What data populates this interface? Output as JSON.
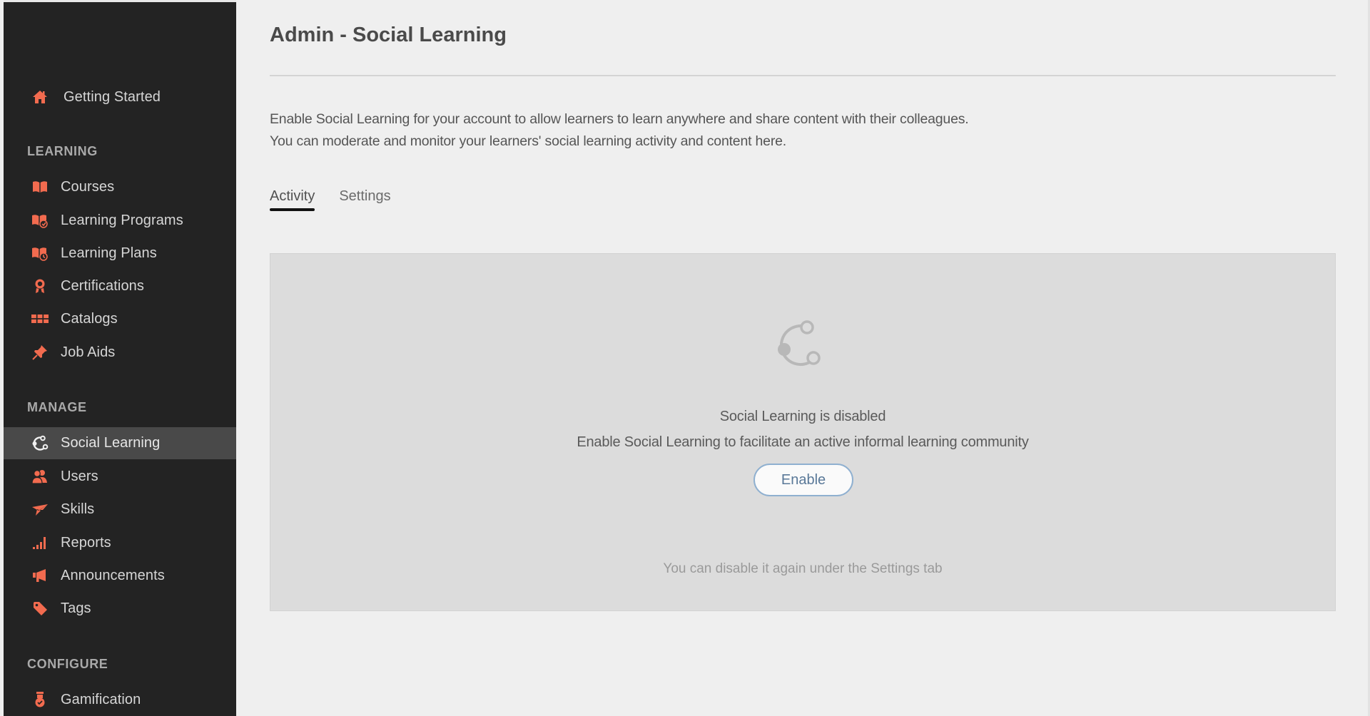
{
  "sidebar": {
    "top_item": {
      "label": "Getting Started",
      "icon": "home-icon"
    },
    "sections": [
      {
        "title": "LEARNING",
        "items": [
          {
            "label": "Courses",
            "icon": "book-icon"
          },
          {
            "label": "Learning Programs",
            "icon": "learning-program-icon"
          },
          {
            "label": "Learning Plans",
            "icon": "learning-plan-icon"
          },
          {
            "label": "Certifications",
            "icon": "certificate-icon"
          },
          {
            "label": "Catalogs",
            "icon": "catalog-grid-icon"
          },
          {
            "label": "Job Aids",
            "icon": "pushpin-icon"
          }
        ]
      },
      {
        "title": "MANAGE",
        "items": [
          {
            "label": "Social Learning",
            "icon": "social-learning-icon",
            "active": true
          },
          {
            "label": "Users",
            "icon": "users-icon"
          },
          {
            "label": "Skills",
            "icon": "skills-icon"
          },
          {
            "label": "Reports",
            "icon": "reports-bars-icon"
          },
          {
            "label": "Announcements",
            "icon": "megaphone-icon"
          },
          {
            "label": "Tags",
            "icon": "tag-icon"
          }
        ]
      },
      {
        "title": "CONFIGURE",
        "items": [
          {
            "label": "Gamification",
            "icon": "gamification-medal-icon"
          }
        ]
      }
    ],
    "accent_color": "#f26b4f",
    "background_color": "#232323",
    "active_background": "#494949"
  },
  "header": {
    "title": "Admin - Social Learning"
  },
  "description": {
    "line1": "Enable Social Learning for your account to allow learners to learn anywhere and share content with their colleagues.",
    "line2": "You can moderate and monitor your learners' social learning activity and content here."
  },
  "tabs": [
    {
      "label": "Activity",
      "active": true
    },
    {
      "label": "Settings",
      "active": false
    }
  ],
  "panel": {
    "icon": "social-learning-icon",
    "status": "Social Learning is disabled",
    "message": "Enable Social Learning to facilitate an active informal learning community",
    "enable_button": "Enable",
    "note": "You can disable it again under the Settings tab"
  }
}
